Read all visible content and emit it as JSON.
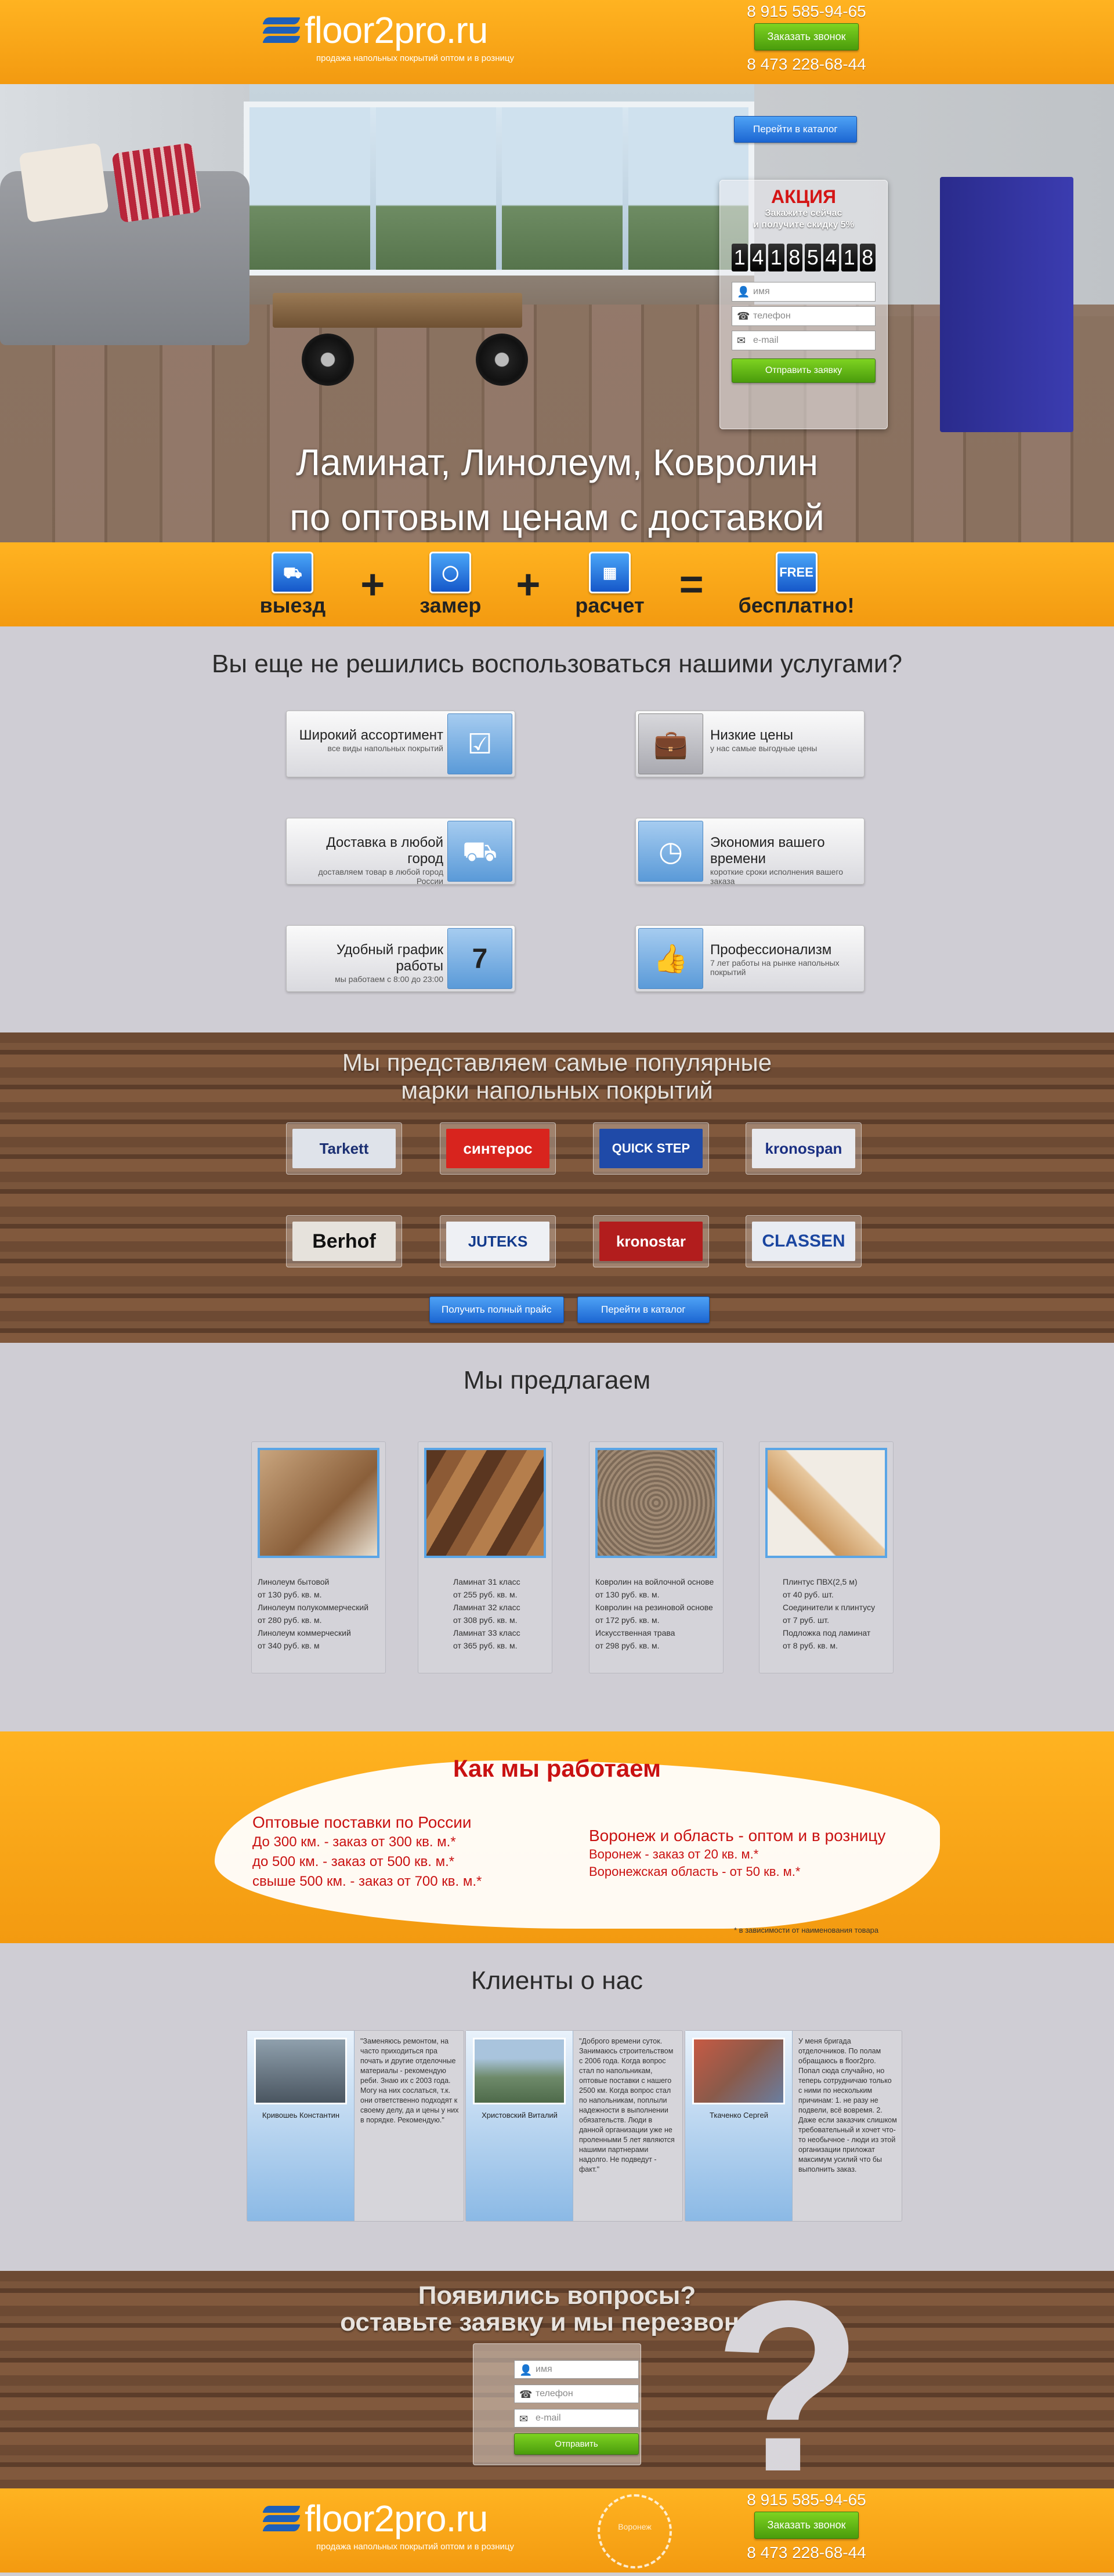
{
  "header": {
    "logo_text": "floor2pro.ru",
    "logo_sub": "продажа напольных покрытий оптом и в розницу",
    "phone1": "8 915 585-94-65",
    "call_button": "Заказать звонок",
    "phone2": "8 473 228-68-44"
  },
  "hero": {
    "catalog_button": "Перейти в каталог",
    "promo_title": "АКЦИЯ",
    "promo_text1": "Закажите сейчас",
    "promo_text2": "и получите скидку 5%",
    "countdown": [
      "1",
      "4",
      "1",
      "8",
      "5",
      "4",
      "1",
      "8"
    ],
    "name_placeholder": "имя",
    "phone_placeholder": "телефон",
    "email_placeholder": "e-mail",
    "submit_button": "Отправить заявку",
    "title_line1": "Ламинат, Линолеум, Ковролин",
    "title_line2": "по оптовым ценам с доставкой"
  },
  "formula": {
    "items": [
      {
        "label": "выезд",
        "icon": "truck-icon"
      },
      {
        "label": "замер",
        "icon": "tape-measure-icon"
      },
      {
        "label": "расчет",
        "icon": "calculator-icon"
      },
      {
        "label": "бесплатно!",
        "icon": "free-icon",
        "badge": "FREE"
      }
    ],
    "plus": "+",
    "equals": "="
  },
  "why": {
    "title": "Вы еще не решились воспользоваться нашими услугами?",
    "features": [
      {
        "title": "Широкий ассортимент",
        "sub": "все виды напольных покрытий",
        "icon": "checklist-icon"
      },
      {
        "title": "Низкие цены",
        "sub": "у нас самые выгодные цены",
        "icon": "wallet-icon"
      },
      {
        "title": "Доставка в любой город",
        "sub": "доставляем товар в любой город России",
        "icon": "delivery-truck-icon"
      },
      {
        "title": "Экономия вашего времени",
        "sub": "короткие сроки исполнения вашего заказа",
        "icon": "clock-icon"
      },
      {
        "title": "Удобный график работы",
        "sub": "мы работаем с 8:00 до 23:00",
        "icon": "calendar-icon",
        "badge": "7"
      },
      {
        "title": "Профессионализм",
        "sub": "7 лет работы на рынке напольных покрытий",
        "icon": "thumbs-up-icon"
      }
    ]
  },
  "brands": {
    "title_line1": "Мы представляем самые популярные",
    "title_line2": "марки напольных покрытий",
    "list": [
      {
        "name": "Tarkett",
        "bg": "#dfe3ea",
        "fg": "#1b2f72"
      },
      {
        "name": "синтерос",
        "bg": "#d8241e",
        "fg": "#ffffff"
      },
      {
        "name": "QUICK STEP",
        "bg": "#1f4aa8",
        "fg": "#ffffff"
      },
      {
        "name": "kronospan",
        "bg": "#e9eaee",
        "fg": "#1a2f82"
      },
      {
        "name": "Berhof",
        "bg": "#e6e2dc",
        "fg": "#111111"
      },
      {
        "name": "JUTEKS",
        "bg": "#eef0f4",
        "fg": "#123a8c"
      },
      {
        "name": "kronostar",
        "bg": "#b21d1d",
        "fg": "#ffffff"
      },
      {
        "name": "CLASSEN",
        "bg": "#e9ecf2",
        "fg": "#1b46a0"
      }
    ],
    "price_button": "Получить полный прайс",
    "catalog_button": "Перейти в каталог"
  },
  "offer": {
    "title": "Мы предлагаем",
    "cards": [
      {
        "lines": [
          "Линолеум бытовой",
          "от 130 руб. кв. м.",
          "Линолеум полукоммерческий",
          "от 280 руб. кв. м.",
          "Линолеум коммерческий",
          "от 340 руб. кв. м"
        ],
        "color": "#a07a55"
      },
      {
        "lines": [
          "Ламинат 31 класс",
          "от 255 руб. кв. м.",
          "Ламинат 32 класс",
          "от 308 руб. кв. м.",
          "Ламинат 33 класс",
          "от 365 руб. кв. м."
        ],
        "color": "#7a4a2a"
      },
      {
        "lines": [
          "Ковролин на войлочной основе",
          "от 130 руб. кв. м.",
          "Ковролин на резиновой основе",
          "от 172 руб. кв. м.",
          "Искусственная трава",
          "от 298 руб. кв. м."
        ],
        "color": "#8f7c6b"
      },
      {
        "lines": [
          "Плинтус ПВХ(2,5 м)",
          "от 40 руб. шт.",
          "Соединители к плинтусу",
          "от 7 руб. шт.",
          "Подложка под ламинат",
          "от 8 руб. кв. м."
        ],
        "color": "#c9a27a"
      }
    ]
  },
  "how": {
    "title": "Как мы работаем",
    "left_title": "Оптовые поставки по России",
    "left_lines": [
      "До 300 км. - заказ от 300 кв. м.*",
      "до 500 км. - заказ от 500 кв. м.*",
      "свыше 500 км. - заказ от 700 кв. м.*"
    ],
    "right_title": "Воронеж и область - оптом и в розницу",
    "right_lines": [
      "Воронеж - заказ от 20 кв. м.*",
      "Воронежская область - от 50 кв. м.*"
    ],
    "footnote": "* в зависимости от наименования товара"
  },
  "reviews": {
    "title": "Клиенты о нас",
    "items": [
      {
        "name": "Кривошеь Константин",
        "text": "\"Заменяюсь ремонтом, на часто приходиться пра почать и другие отделочные материалы - рекомендую реби. Знаю их с 2003 года. Могу на них сослаться, т.к. они ответственно подходят к своему делу, да и цены у них в порядке. Рекомендую.\"",
        "photo": "#6f7f8c"
      },
      {
        "name": "Христовский Виталий",
        "text": "\"Доброго времени суток. Занимаюсь строительством с 2006 года. Когда вопрос стал по напольникам, оптовые поставки с нашего 2500 км. Когда вопрос стал по напольникам, поплыли надежности в выполнении обязательств. Люди в данной организации уже не проленными 5 лет являются нашими партнерами надолго. Не подведут - факт.\"",
        "photo": "#6e8a6a"
      },
      {
        "name": "Ткаченко Сергей",
        "text": "У меня бригада отделочников. По полам обращаюсь в floor2pro. Попал сюда случайно, но теперь сотрудничаю только с ними по нескольким причинам: 1. не разу не подвели, всё вовремя. 2. Даже если заказчик слишком требовательный и хочет что-то необычное - люди из этой организации приложат максимум усилий что бы выполнить заказ.",
        "photo": "#8a6a5a"
      }
    ]
  },
  "callback": {
    "title_line1": "Появились вопросы?",
    "title_line2": "оставьте заявку и мы перезвоним",
    "name_placeholder": "имя",
    "phone_placeholder": "телефон",
    "email_placeholder": "e-mail",
    "submit_button": "Отправить"
  },
  "footer": {
    "logo_text": "floor2pro.ru",
    "logo_sub": "продажа напольных покрытий оптом и в розницу",
    "seal_text": "Воронеж",
    "phone1": "8 915 585-94-65",
    "call_button": "Заказать звонок",
    "phone2": "8 473 228-68-44"
  }
}
